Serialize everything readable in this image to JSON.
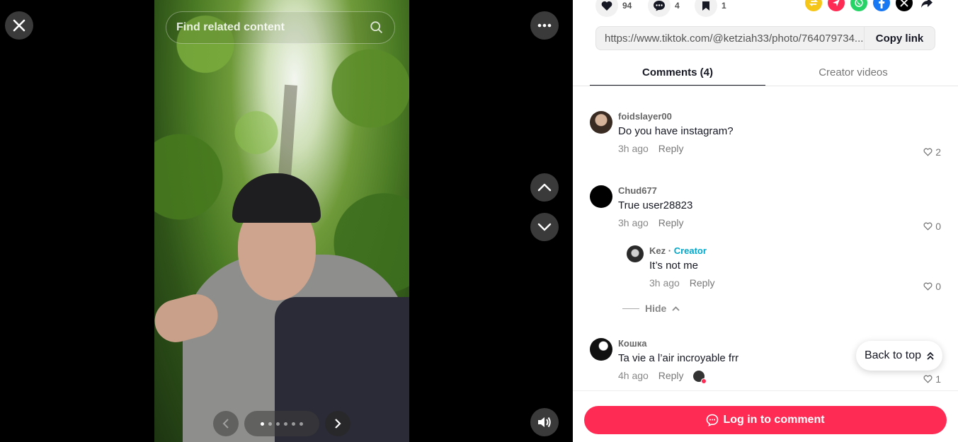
{
  "viewer": {
    "search_placeholder": "Find related content",
    "photo_dots": {
      "count": 6,
      "active_index": 0
    }
  },
  "actions": {
    "likes": "94",
    "comments": "4",
    "saves": "1"
  },
  "share": {
    "url": "https://www.tiktok.com/@ketziah33/photo/764079734...",
    "copy_label": "Copy link",
    "colors": {
      "repost": "#f5c518",
      "location": "#fe2c55",
      "whatsapp": "#25d366",
      "facebook": "#1877f2",
      "x": "#000000"
    }
  },
  "tabs": {
    "comments": "Comments (4)",
    "creator_videos": "Creator videos"
  },
  "comments": [
    {
      "user": "foidslayer00",
      "text": "Do you have instagram?",
      "time": "3h ago",
      "reply": "Reply",
      "likes": "2"
    },
    {
      "user": "Chud677",
      "text": "True user28823",
      "time": "3h ago",
      "reply": "Reply",
      "likes": "0",
      "replies": [
        {
          "user": "Kez",
          "separator": " · ",
          "badge": "Creator",
          "text": "It’s not me",
          "time": "3h ago",
          "reply": "Reply",
          "likes": "0"
        }
      ],
      "hide_label": "Hide"
    },
    {
      "user": "Кошка",
      "text": "Ta vie a l’air incroyable frr",
      "time": "4h ago",
      "reply": "Reply",
      "likes": "1"
    }
  ],
  "back_to_top": "Back to top",
  "login_button": "Log in to comment"
}
